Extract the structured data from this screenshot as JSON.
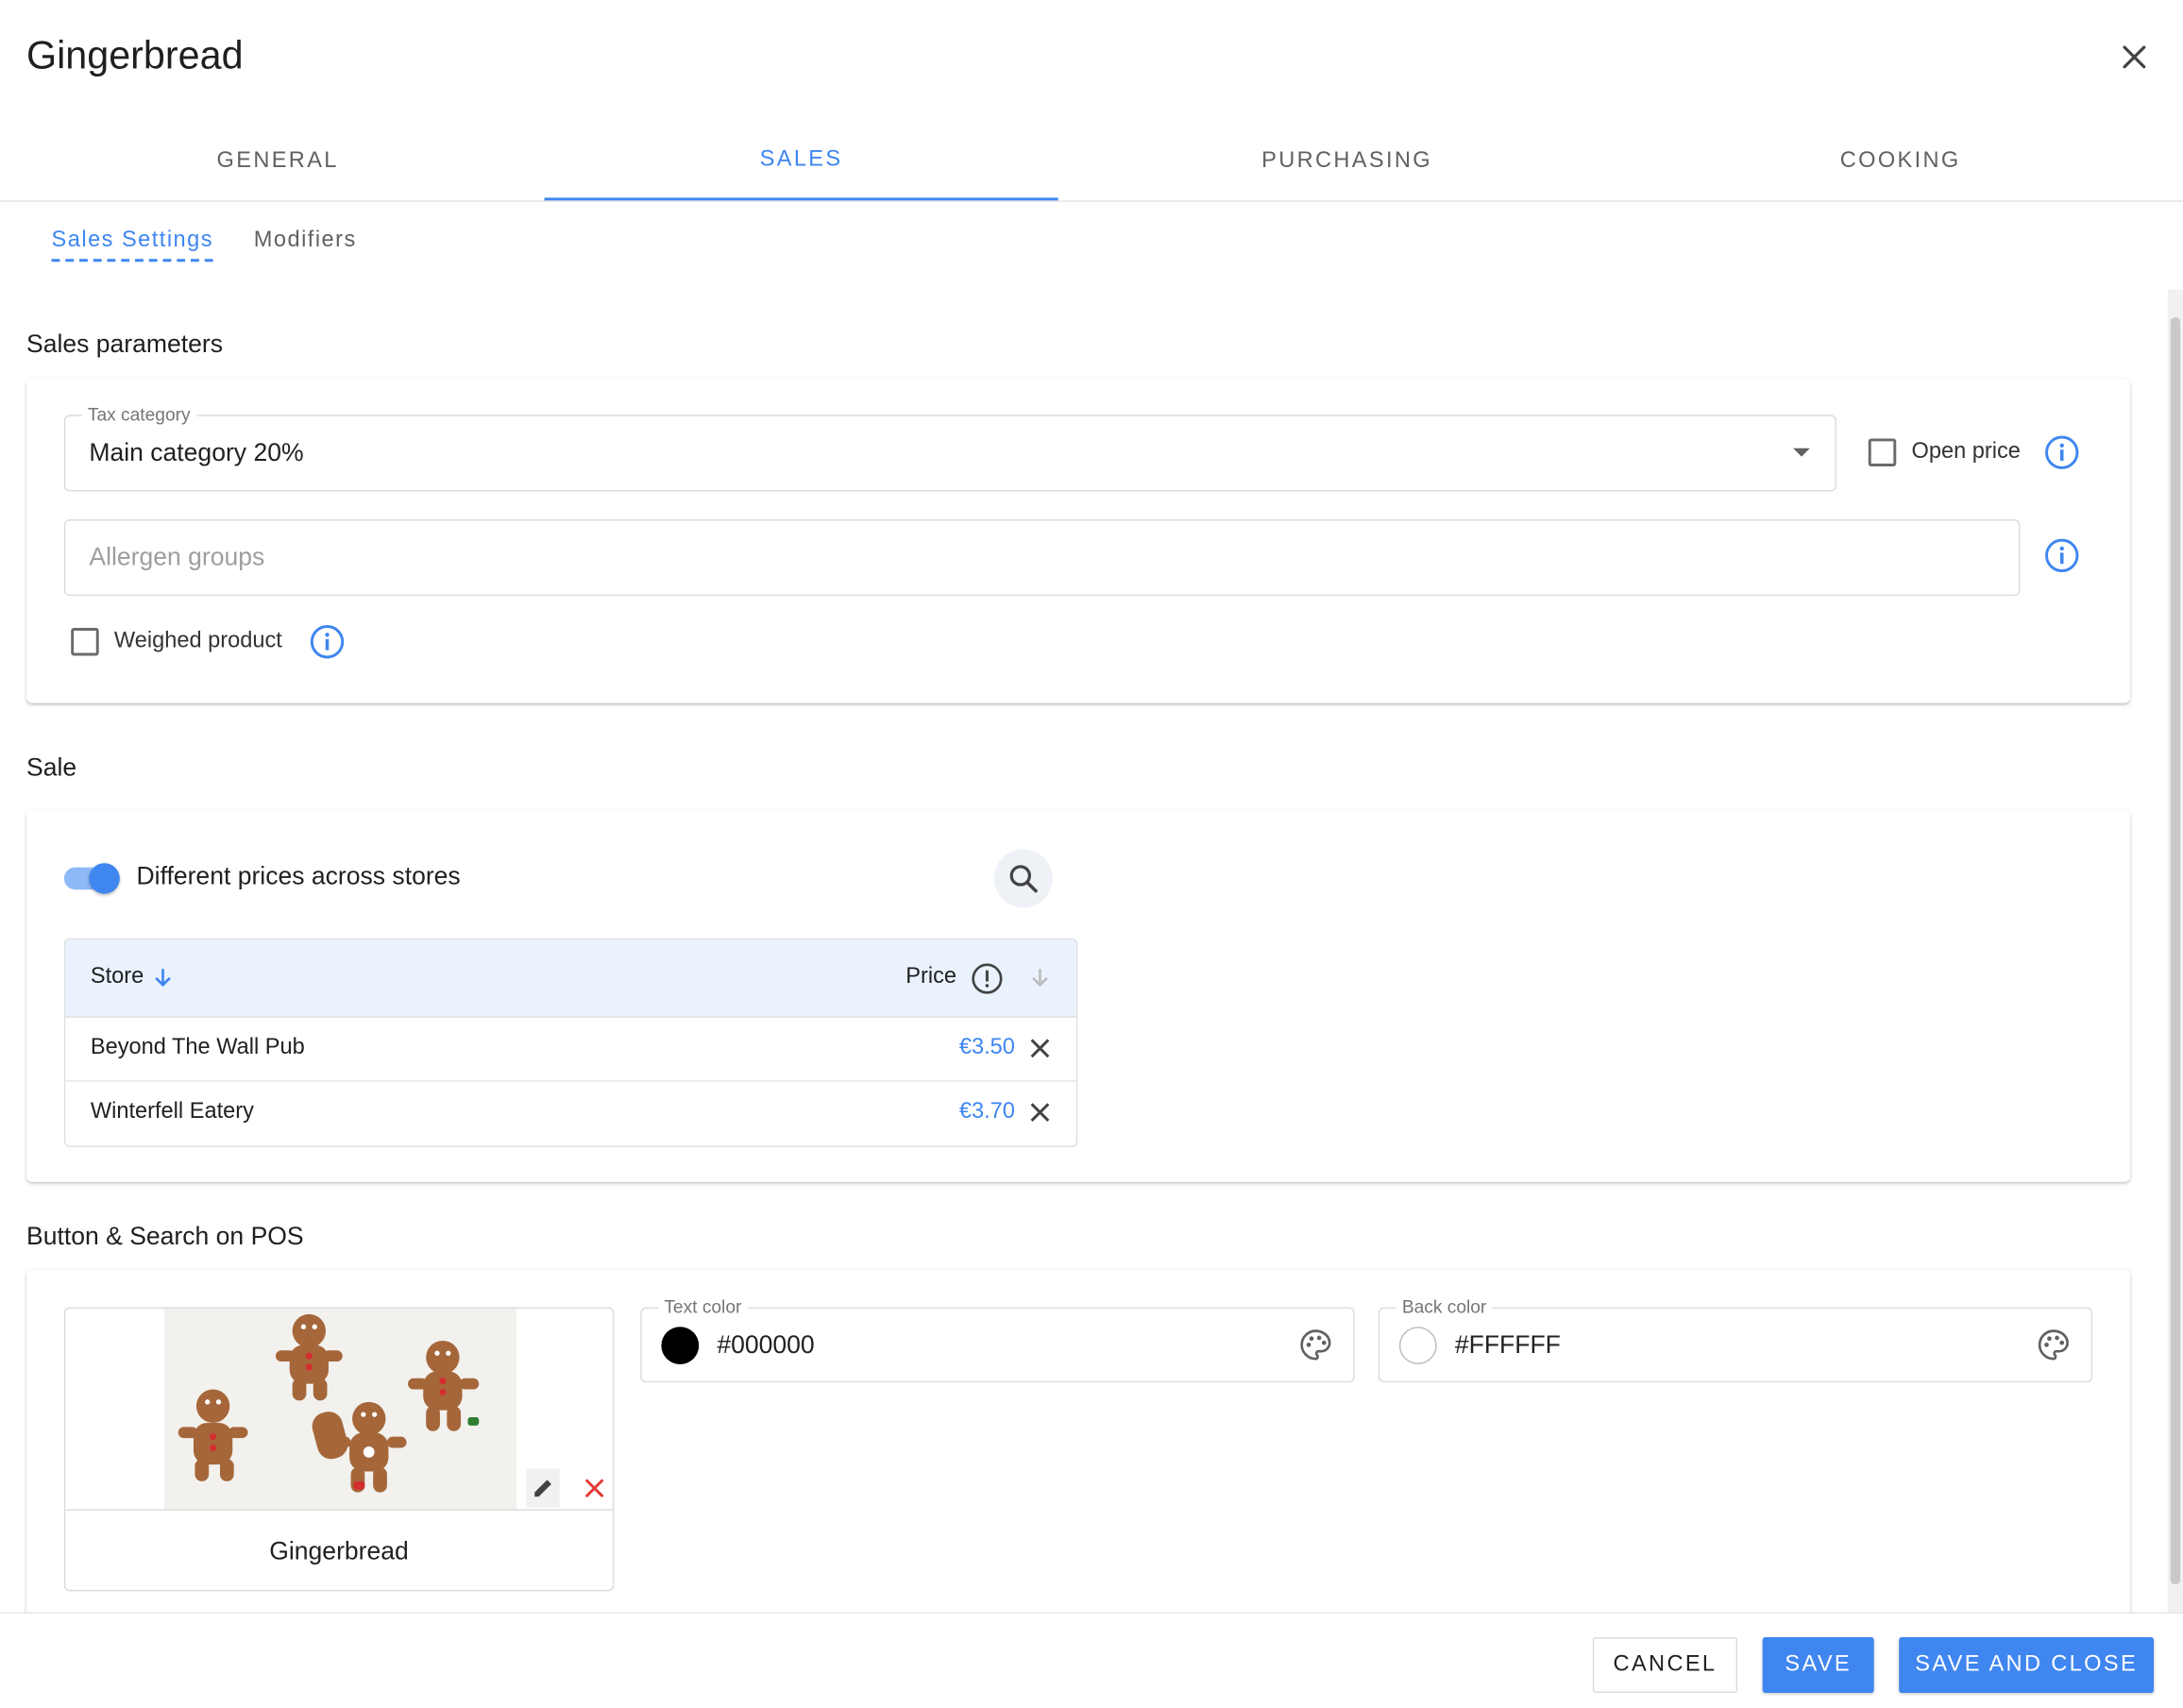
{
  "dialog": {
    "title": "Gingerbread"
  },
  "tabs": [
    {
      "label": "GENERAL"
    },
    {
      "label": "SALES",
      "active": true
    },
    {
      "label": "PURCHASING"
    },
    {
      "label": "COOKING"
    }
  ],
  "subtabs": [
    {
      "label": "Sales Settings",
      "active": true
    },
    {
      "label": "Modifiers"
    }
  ],
  "sales_parameters": {
    "title": "Sales parameters",
    "tax_category": {
      "label": "Tax category",
      "value": "Main category 20%"
    },
    "open_price": {
      "label": "Open price",
      "checked": false
    },
    "allergen_groups": {
      "placeholder": "Allergen groups"
    },
    "weighed_product": {
      "label": "Weighed product",
      "checked": false
    }
  },
  "sale": {
    "title": "Sale",
    "different_prices": {
      "label": "Different prices across stores",
      "on": true
    },
    "table": {
      "columns": {
        "store": "Store",
        "price": "Price"
      },
      "rows": [
        {
          "store": "Beyond The Wall Pub",
          "price": "€3.50"
        },
        {
          "store": "Winterfell Eatery",
          "price": "€3.70"
        }
      ]
    }
  },
  "pos": {
    "title": "Button & Search on POS",
    "button_name": "Gingerbread",
    "text_color": {
      "label": "Text color",
      "value": "#000000"
    },
    "back_color": {
      "label": "Back color",
      "value": "#FFFFFF"
    }
  },
  "footer": {
    "cancel": "CANCEL",
    "save": "SAVE",
    "save_and_close": "SAVE AND CLOSE"
  },
  "colors": {
    "accent": "#3f86f0",
    "danger": "#e53935"
  }
}
